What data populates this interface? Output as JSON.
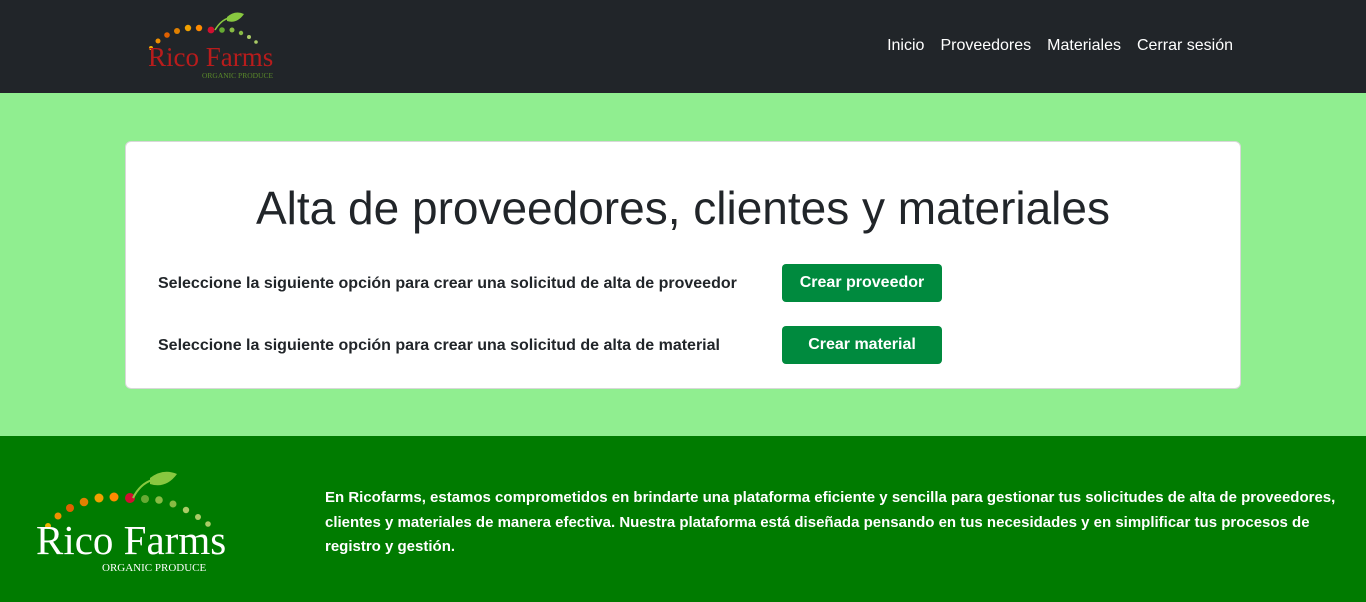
{
  "nav": {
    "logo": {
      "brand": "Rico Farms",
      "tagline": "ORGANIC PRODUCE"
    },
    "links": [
      "Inicio",
      "Proveedores",
      "Materiales",
      "Cerrar sesión"
    ]
  },
  "main": {
    "title": "Alta de proveedores, clientes y materiales",
    "rows": [
      {
        "label": "Seleccione la siguiente opción para crear una solicitud de alta de proveedor",
        "button": "Crear proveedor"
      },
      {
        "label": "Seleccione la siguiente opción para crear una solicitud de alta de material",
        "button": "Crear material"
      }
    ]
  },
  "footer": {
    "logo": {
      "brand": "Rico Farms",
      "tagline": "ORGANIC PRODUCE"
    },
    "text": "En Ricofarms, estamos comprometidos en brindarte una plataforma eficiente y sencilla para gestionar tus solicitudes de alta de proveedores, clientes y materiales de manera efectiva. Nuestra plataforma está diseñada pensando en tus necesidades y en simplificar tus procesos de registro y gestión."
  },
  "colors": {
    "navbar": "#212529",
    "page_bg": "#90ee90",
    "button": "#008a3e",
    "footer": "#007b00"
  }
}
